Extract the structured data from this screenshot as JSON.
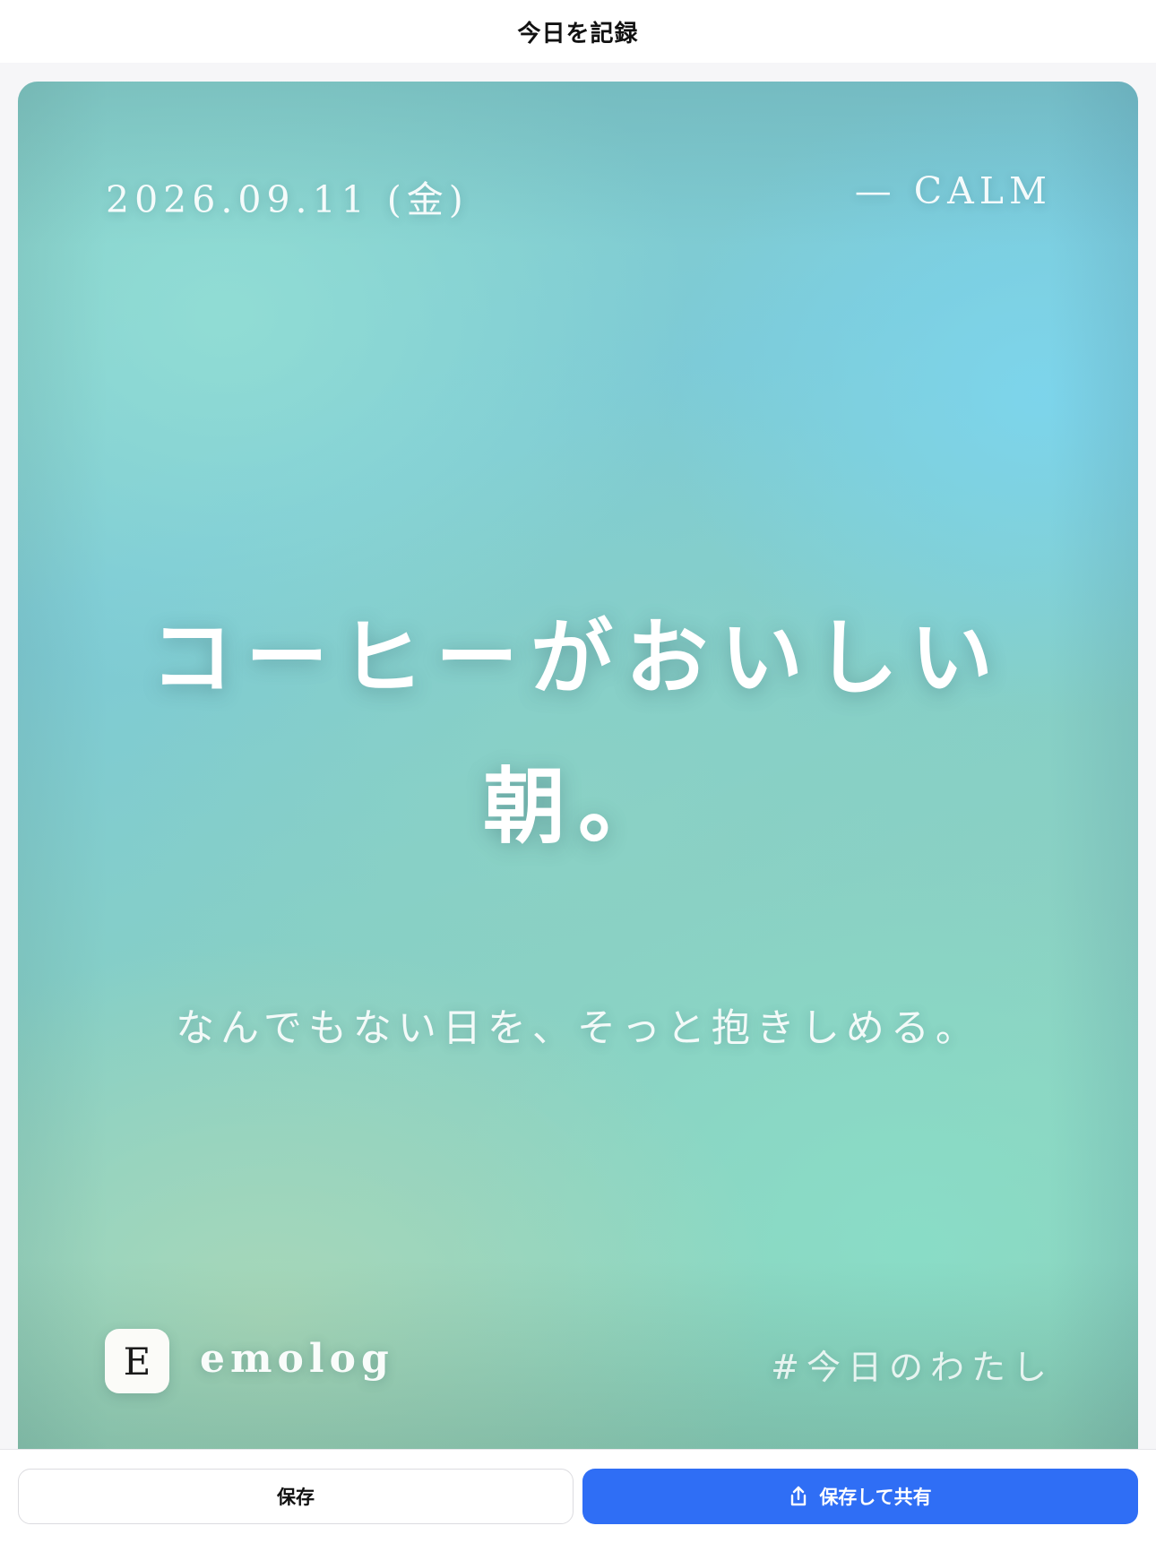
{
  "header": {
    "title": "今日を記録"
  },
  "card": {
    "date": "2026.09.11 (金)",
    "mood": "— CALM",
    "main_line_1": "コーヒーがおいしい",
    "main_line_2": "朝。",
    "subtitle": "なんでもない日を、そっと抱きしめる。",
    "logo_letter": "E",
    "brand": "emolog",
    "hashtag": "#今日のわたし"
  },
  "actions": {
    "save_label": "保存",
    "share_label": "保存して共有",
    "share_icon": "share-icon"
  },
  "colors": {
    "accent": "#2f6ef5",
    "card_blue": "#7cd6f0",
    "card_mint": "#8ed3c0",
    "card_green": "#aad8b8"
  }
}
